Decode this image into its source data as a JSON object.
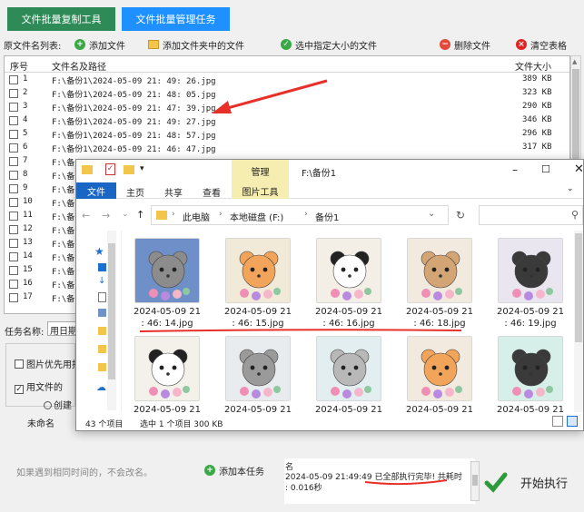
{
  "tabs": [
    "文件批量复制工具",
    "文件批量管理任务"
  ],
  "toolbar": {
    "source_label": "原文件名列表:",
    "add_file": "添加文件",
    "add_folder": "添加文件夹中的文件",
    "select_size": "选中指定大小的文件",
    "delete_file": "删除文件",
    "clear_table": "清空表格"
  },
  "table": {
    "headers": {
      "index": "序号",
      "name": "文件名及路径",
      "size": "文件大小"
    },
    "rows": [
      {
        "idx": "1",
        "path": "F:\\备份1\\2024-05-09 21: 49: 26.jpg",
        "size": "389 KB"
      },
      {
        "idx": "2",
        "path": "F:\\备份1\\2024-05-09 21: 48: 05.jpg",
        "size": "323 KB"
      },
      {
        "idx": "3",
        "path": "F:\\备份1\\2024-05-09 21: 47: 39.jpg",
        "size": "290 KB"
      },
      {
        "idx": "4",
        "path": "F:\\备份1\\2024-05-09 21: 49: 27.jpg",
        "size": "346 KB"
      },
      {
        "idx": "5",
        "path": "F:\\备份1\\2024-05-09 21: 48: 57.jpg",
        "size": "296 KB"
      },
      {
        "idx": "6",
        "path": "F:\\备份1\\2024-05-09 21: 46: 47.jpg",
        "size": "317 KB"
      },
      {
        "idx": "7",
        "path": "F:\\备",
        "size": ""
      },
      {
        "idx": "8",
        "path": "F:\\备",
        "size": ""
      },
      {
        "idx": "9",
        "path": "F:\\备",
        "size": ""
      },
      {
        "idx": "10",
        "path": "F:\\备",
        "size": ""
      },
      {
        "idx": "11",
        "path": "F:\\备",
        "size": ""
      },
      {
        "idx": "12",
        "path": "F:\\备",
        "size": ""
      },
      {
        "idx": "13",
        "path": "F:\\备",
        "size": ""
      },
      {
        "idx": "14",
        "path": "F:\\备",
        "size": ""
      },
      {
        "idx": "15",
        "path": "F:\\备",
        "size": ""
      },
      {
        "idx": "16",
        "path": "F:\\备",
        "size": ""
      },
      {
        "idx": "17",
        "path": "F:\\备",
        "size": ""
      }
    ]
  },
  "explorer": {
    "ribbon_context": "管理",
    "title": "F:\\备份1",
    "ribbon_tabs": [
      "文件",
      "主页",
      "共享",
      "查看",
      "图片工具"
    ],
    "breadcrumb": [
      "此电脑",
      "本地磁盘 (F:)",
      "备份1"
    ],
    "files": [
      {
        "line1": "2024-05-09 21",
        "line2": ": 46: 14.jpg",
        "animal": "raccoon-moon",
        "bg": "#6f8fc8"
      },
      {
        "line1": "2024-05-09 21",
        "line2": ": 46: 15.jpg",
        "animal": "fox",
        "bg": "#f1ead8"
      },
      {
        "line1": "2024-05-09 21",
        "line2": ": 46: 16.jpg",
        "animal": "panda",
        "bg": "#f3eee6"
      },
      {
        "line1": "2024-05-09 21",
        "line2": ": 46: 18.jpg",
        "animal": "bear",
        "bg": "#f3eadf"
      },
      {
        "line1": "2024-05-09 21",
        "line2": ": 46: 19.jpg",
        "animal": "penguin",
        "bg": "#e9e6f0"
      },
      {
        "line1": "2024-05-09 21",
        "line2": "",
        "animal": "panda-2",
        "bg": "#f4f1ea"
      },
      {
        "line1": "2024-05-09 21",
        "line2": "",
        "animal": "raccoon",
        "bg": "#e8ecee"
      },
      {
        "line1": "2024-05-09 21",
        "line2": "",
        "animal": "koala",
        "bg": "#e2eef0"
      },
      {
        "line1": "2024-05-09 21",
        "line2": "",
        "animal": "fox-2",
        "bg": "#f2eadf"
      },
      {
        "line1": "2024-05-09 21",
        "line2": "",
        "animal": "penguin-2",
        "bg": "#d6efe8"
      }
    ],
    "status_count": "43 个项目",
    "status_selected": "选中 1 个项目  300 KB"
  },
  "bottom": {
    "task_label": "任务名称:",
    "task_value": "用日期",
    "opt_image_first": "图片优先用拍",
    "opt_use_file": "用文件的",
    "opt_create": "创建",
    "unnamed": "未命名",
    "note": "如果遇到相同时间的，不会改名。",
    "add_task": "添加本任务",
    "log_header": "名",
    "log_line1": "2024-05-09 21:49:49 已全部执行完毕! 共耗时",
    "log_line2": ": 0.016秒",
    "start": "开始执行"
  },
  "colors": {
    "tab_active": "#1e90ff",
    "tab_inactive": "#2e8b57",
    "accent_red": "#e02424",
    "green": "#3aa845"
  }
}
